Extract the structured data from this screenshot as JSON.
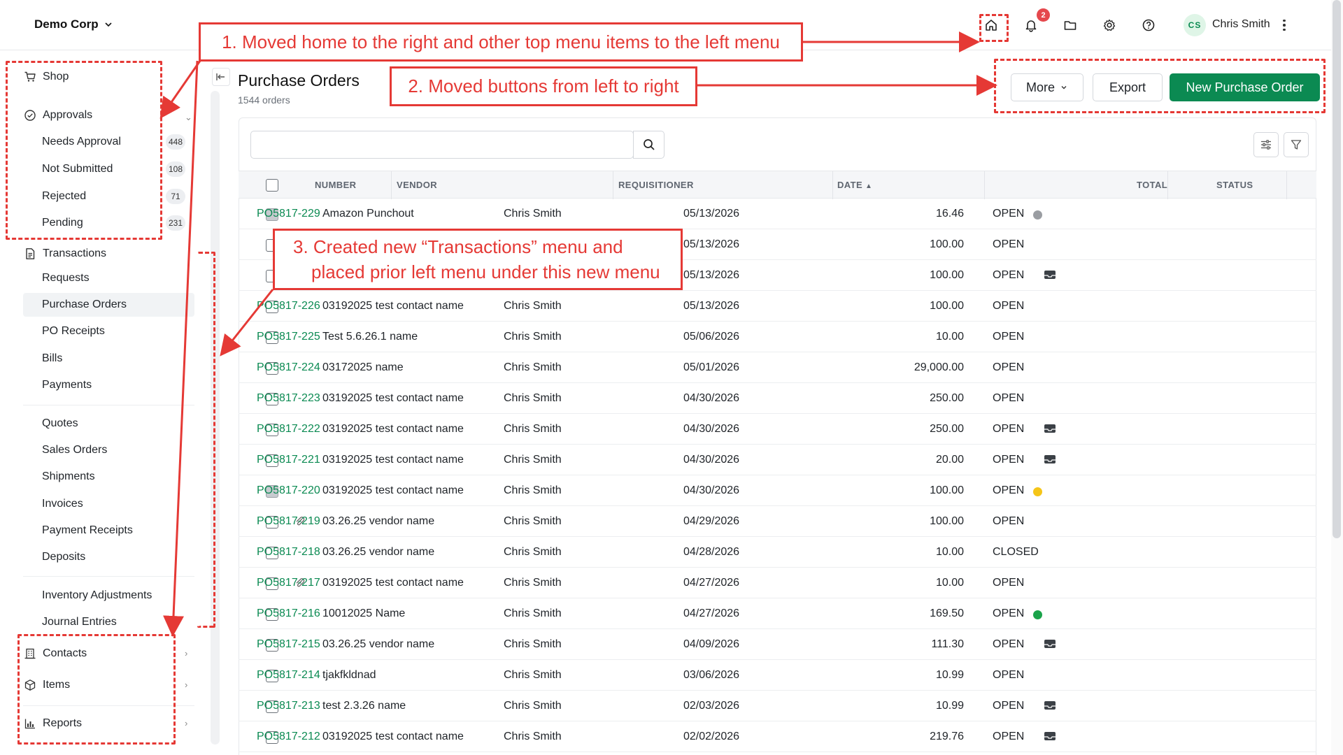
{
  "header": {
    "company": "Demo Corp",
    "notification_count": "2",
    "user_initials": "CS",
    "user_name": "Chris Smith"
  },
  "sidebar": {
    "shop": "Shop",
    "approvals": "Approvals",
    "approval_items": [
      {
        "label": "Needs Approval",
        "count": "448"
      },
      {
        "label": "Not Submitted",
        "count": "108"
      },
      {
        "label": "Rejected",
        "count": "71"
      },
      {
        "label": "Pending",
        "count": "231"
      }
    ],
    "transactions": "Transactions",
    "transaction_items": [
      "Requests",
      "Purchase Orders",
      "PO Receipts",
      "Bills",
      "Payments",
      "Quotes",
      "Sales Orders",
      "Shipments",
      "Invoices",
      "Payment Receipts",
      "Deposits",
      "Inventory Adjustments",
      "Journal Entries"
    ],
    "contacts": "Contacts",
    "items": "Items",
    "reports": "Reports"
  },
  "page": {
    "title": "Purchase Orders",
    "subtitle": "1544 orders",
    "more_label": "More",
    "export_label": "Export",
    "new_label": "New Purchase Order",
    "search_placeholder": ""
  },
  "table": {
    "columns": [
      "NUMBER",
      "VENDOR",
      "REQUISITIONER",
      "DATE",
      "TOTAL",
      "STATUS"
    ],
    "rows": [
      {
        "number": "PO5817-229",
        "vendor": "Amazon Punchout",
        "req": "Chris Smith",
        "date": "05/13/2026",
        "total": "16.46",
        "status": "OPEN",
        "marker": "dot-gray",
        "check": "gray"
      },
      {
        "number": "",
        "vendor": "",
        "req": "",
        "date": "05/13/2026",
        "total": "100.00",
        "status": "OPEN",
        "marker": "",
        "check": ""
      },
      {
        "number": "",
        "vendor": "",
        "req": "",
        "date": "05/13/2026",
        "total": "100.00",
        "status": "OPEN",
        "marker": "inbox",
        "check": ""
      },
      {
        "number": "PO5817-226",
        "vendor": "03192025 test contact name",
        "req": "Chris Smith",
        "date": "05/13/2026",
        "total": "100.00",
        "status": "OPEN",
        "marker": "",
        "check": ""
      },
      {
        "number": "PO5817-225",
        "vendor": "Test 5.6.26.1 name",
        "req": "Chris Smith",
        "date": "05/06/2026",
        "total": "10.00",
        "status": "OPEN",
        "marker": "",
        "check": ""
      },
      {
        "number": "PO5817-224",
        "vendor": "03172025 name",
        "req": "Chris Smith",
        "date": "05/01/2026",
        "total": "29,000.00",
        "status": "OPEN",
        "marker": "",
        "check": ""
      },
      {
        "number": "PO5817-223",
        "vendor": "03192025 test contact name",
        "req": "Chris Smith",
        "date": "04/30/2026",
        "total": "250.00",
        "status": "OPEN",
        "marker": "",
        "check": ""
      },
      {
        "number": "PO5817-222",
        "vendor": "03192025 test contact name",
        "req": "Chris Smith",
        "date": "04/30/2026",
        "total": "250.00",
        "status": "OPEN",
        "marker": "inbox",
        "check": ""
      },
      {
        "number": "PO5817-221",
        "vendor": "03192025 test contact name",
        "req": "Chris Smith",
        "date": "04/30/2026",
        "total": "20.00",
        "status": "OPEN",
        "marker": "inbox",
        "check": ""
      },
      {
        "number": "PO5817-220",
        "vendor": "03192025 test contact name",
        "req": "Chris Smith",
        "date": "04/30/2026",
        "total": "100.00",
        "status": "OPEN",
        "marker": "dot-yellow",
        "check": "gray"
      },
      {
        "number": "PO5817-219",
        "vendor": "03.26.25 vendor name",
        "req": "Chris Smith",
        "date": "04/29/2026",
        "total": "100.00",
        "status": "OPEN",
        "marker": "",
        "check": "",
        "clip": true
      },
      {
        "number": "PO5817-218",
        "vendor": "03.26.25 vendor name",
        "req": "Chris Smith",
        "date": "04/28/2026",
        "total": "10.00",
        "status": "CLOSED",
        "marker": "",
        "check": ""
      },
      {
        "number": "PO5817-217",
        "vendor": "03192025 test contact name",
        "req": "Chris Smith",
        "date": "04/27/2026",
        "total": "10.00",
        "status": "OPEN",
        "marker": "",
        "check": "",
        "clip": true
      },
      {
        "number": "PO5817-216",
        "vendor": "10012025 Name",
        "req": "Chris Smith",
        "date": "04/27/2026",
        "total": "169.50",
        "status": "OPEN",
        "marker": "dot-green",
        "check": ""
      },
      {
        "number": "PO5817-215",
        "vendor": "03.26.25 vendor name",
        "req": "Chris Smith",
        "date": "04/09/2026",
        "total": "111.30",
        "status": "OPEN",
        "marker": "inbox",
        "check": ""
      },
      {
        "number": "PO5817-214",
        "vendor": "tjakfkldnad",
        "req": "Chris Smith",
        "date": "03/06/2026",
        "total": "10.99",
        "status": "OPEN",
        "marker": "",
        "check": ""
      },
      {
        "number": "PO5817-213",
        "vendor": "test 2.3.26 name",
        "req": "Chris Smith",
        "date": "02/03/2026",
        "total": "10.99",
        "status": "OPEN",
        "marker": "inbox",
        "check": ""
      },
      {
        "number": "PO5817-212",
        "vendor": "03192025 test contact name",
        "req": "Chris Smith",
        "date": "02/02/2026",
        "total": "219.76",
        "status": "OPEN",
        "marker": "inbox",
        "check": ""
      }
    ]
  },
  "annotations": {
    "note1": "1. Moved home to the right and other top menu items to the left menu",
    "note2": "2. Moved buttons from left to right",
    "note3_line1": "3. Created new “Transactions” menu and",
    "note3_line2": "placed prior left menu under this new menu"
  },
  "colors": {
    "accent": "#0b8a52",
    "annotation": "#e53935",
    "badge": "#e5484d",
    "dot_gray": "#9a9da2",
    "dot_yellow": "#f5c518",
    "dot_green": "#1aa34a"
  },
  "icons": {
    "home": "home-icon",
    "bell": "bell-icon",
    "folder": "folder-icon",
    "settings": "gear-icon",
    "help": "help-icon",
    "cart": "cart-icon",
    "approvals": "check-circle-icon",
    "transactions": "document-icon",
    "contacts": "building-icon",
    "items": "box-icon",
    "reports": "bar-chart-icon"
  }
}
